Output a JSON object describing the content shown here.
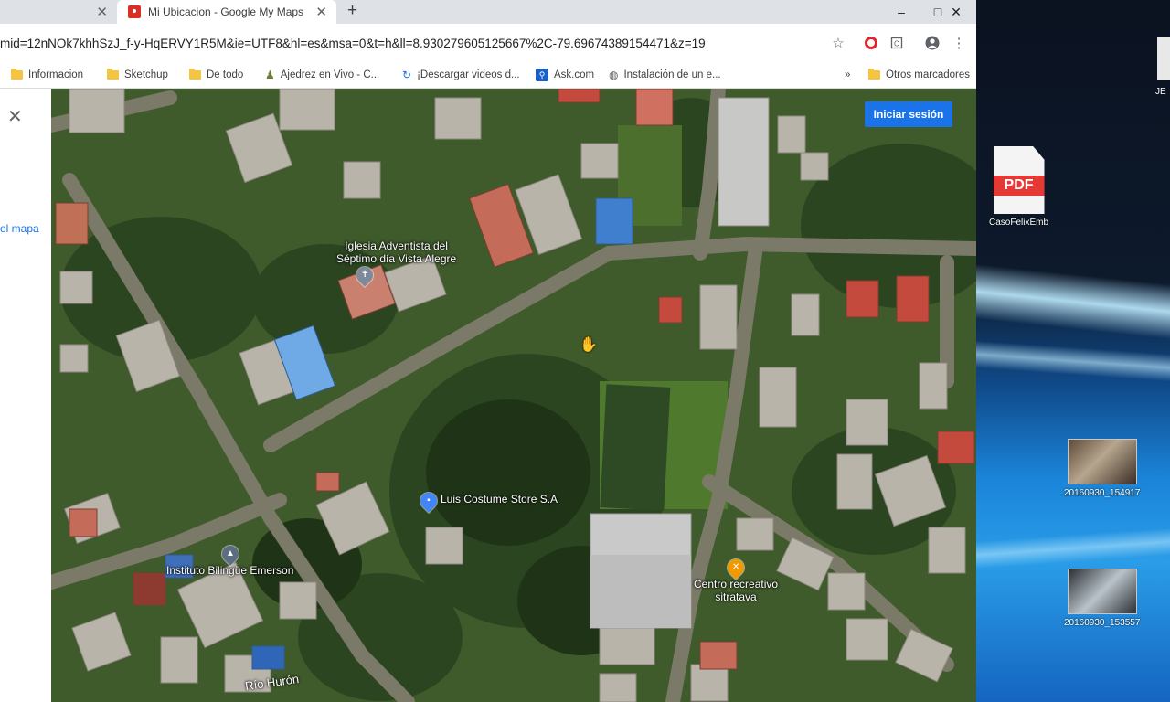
{
  "browser": {
    "tabs": [
      {
        "label": "",
        "active": false
      },
      {
        "label": "Mi Ubicacion - Google My Maps",
        "active": true
      }
    ],
    "new_tab": "+",
    "window_controls": {
      "minimize": "–",
      "maximize": "□",
      "close": "✕"
    },
    "url": "mid=12nNOk7khhSzJ_f-y-HqERVY1R5M&ie=UTF8&hl=es&msa=0&t=h&ll=8.930279605125667%2C-79.69674389154471&z=19",
    "bookmarks": [
      {
        "label": "Informacion",
        "icon": "folder-icon"
      },
      {
        "label": "Sketchup",
        "icon": "folder-icon"
      },
      {
        "label": "De todo",
        "icon": "folder-icon"
      },
      {
        "label": "Ajedrez en Vivo - C...",
        "icon": "chess-icon"
      },
      {
        "label": "¡Descargar videos d...",
        "icon": "refresh-icon"
      },
      {
        "label": "Ask.com",
        "icon": "search-icon"
      },
      {
        "label": "Instalación de un e...",
        "icon": "globe-icon"
      }
    ],
    "bookmarks_more": "»",
    "other_bookmarks": "Otros marcadores"
  },
  "panel": {
    "close": "✕",
    "link_fragment": "el mapa"
  },
  "map": {
    "login_button": "Iniciar sesión",
    "places": [
      {
        "name_line1": "Iglesia Adventista del",
        "name_line2": "Séptimo día Vista Alegre",
        "icon": "church-icon",
        "color": "#7e8a99"
      },
      {
        "name_line1": "Luis Costume Store S.A",
        "name_line2": "",
        "icon": "store-icon",
        "color": "#4285f4"
      },
      {
        "name_line1": "Instituto Bilingüe Emerson",
        "name_line2": "",
        "icon": "school-icon",
        "color": "#5b6d80"
      },
      {
        "name_line1": "Centro recreativo",
        "name_line2": "sitratava",
        "icon": "restaurant-icon",
        "color": "#f29900"
      }
    ],
    "river_label": "Río Hurón"
  },
  "desktop": {
    "icons": [
      {
        "label": "CasoFelixEmb",
        "type": "pdf",
        "badge": "PDF"
      },
      {
        "label": "20160930_154917",
        "type": "image"
      },
      {
        "label": "20160930_153557",
        "type": "image"
      }
    ],
    "cut_label": "JE"
  }
}
